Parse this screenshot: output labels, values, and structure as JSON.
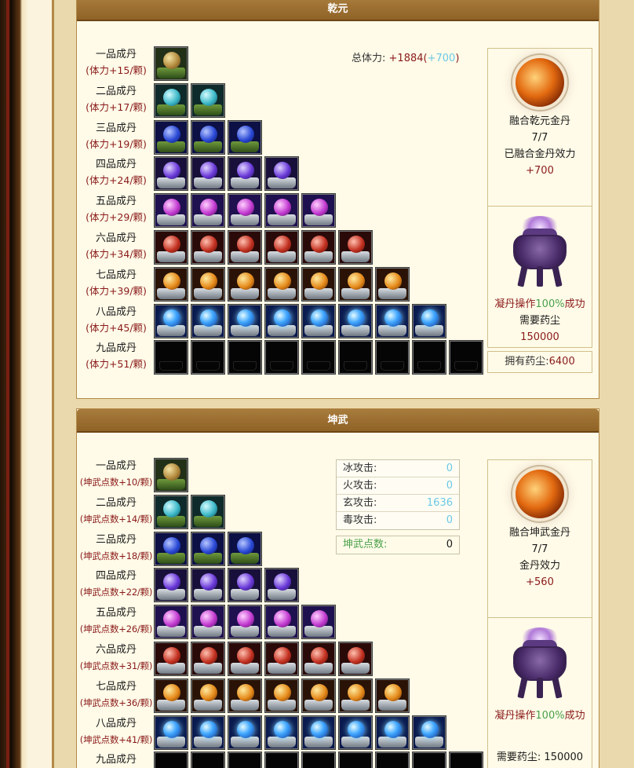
{
  "qianyuan": {
    "title": "乾元",
    "total_label": "总体力:",
    "total_value": "+1884",
    "total_open": "(",
    "total_plus": "+700",
    "total_close": ")",
    "grades": [
      {
        "name": "一品成丹",
        "bonus": "(体力+15/颗)",
        "filled": 1,
        "color": "c1"
      },
      {
        "name": "二品成丹",
        "bonus": "(体力+17/颗)",
        "filled": 2,
        "color": "c2"
      },
      {
        "name": "三品成丹",
        "bonus": "(体力+19/颗)",
        "filled": 3,
        "color": "c3"
      },
      {
        "name": "四品成丹",
        "bonus": "(体力+24/颗)",
        "filled": 4,
        "color": "c4"
      },
      {
        "name": "五品成丹",
        "bonus": "(体力+29/颗)",
        "filled": 5,
        "color": "c5"
      },
      {
        "name": "六品成丹",
        "bonus": "(体力+34/颗)",
        "filled": 6,
        "color": "c6"
      },
      {
        "name": "七品成丹",
        "bonus": "(体力+39/颗)",
        "filled": 7,
        "color": "c7"
      },
      {
        "name": "八品成丹",
        "bonus": "(体力+45/颗)",
        "filled": 8,
        "color": "c8"
      },
      {
        "name": "九品成丹",
        "bonus": "(体力+51/颗)",
        "filled": 0,
        "slots": 9,
        "color": "c9"
      }
    ],
    "fuse_title": "融合乾元金丹",
    "fuse_count": "7/7",
    "fuse_effect_label": "已融合金丹效力",
    "fuse_effect_value": "+700",
    "condense_prefix": "凝丹操作",
    "condense_rate": "100%",
    "condense_suffix": "成功",
    "dust_need_label": "需要药尘",
    "dust_need_value": "150000",
    "owned_dust_label": "拥有药尘:",
    "owned_dust_value": "6400"
  },
  "kunwu": {
    "title": "坤武",
    "grades": [
      {
        "name": "一品成丹",
        "bonus": "(坤武点数+10/颗)",
        "filled": 1,
        "color": "c1"
      },
      {
        "name": "二品成丹",
        "bonus": "(坤武点数+14/颗)",
        "filled": 2,
        "color": "c2"
      },
      {
        "name": "三品成丹",
        "bonus": "(坤武点数+18/颗)",
        "filled": 3,
        "color": "c3"
      },
      {
        "name": "四品成丹",
        "bonus": "(坤武点数+22/颗)",
        "filled": 4,
        "color": "c4"
      },
      {
        "name": "五品成丹",
        "bonus": "(坤武点数+26/颗)",
        "filled": 5,
        "color": "c5"
      },
      {
        "name": "六品成丹",
        "bonus": "(坤武点数+31/颗)",
        "filled": 6,
        "color": "c6"
      },
      {
        "name": "七品成丹",
        "bonus": "(坤武点数+36/颗)",
        "filled": 7,
        "color": "c7"
      },
      {
        "name": "八品成丹",
        "bonus": "(坤武点数+41/颗)",
        "filled": 8,
        "color": "c8"
      },
      {
        "name": "九品成丹",
        "bonus": "",
        "filled": 0,
        "slots": 9,
        "color": "c9"
      }
    ],
    "attacks": [
      {
        "label": "冰攻击:",
        "value": "0"
      },
      {
        "label": "火攻击:",
        "value": "0"
      },
      {
        "label": "玄攻击:",
        "value": "1636"
      },
      {
        "label": "毒攻击:",
        "value": "0"
      }
    ],
    "points_label": "坤武点数:",
    "points_value": "0",
    "fuse_title": "融合坤武金丹",
    "fuse_count": "7/7",
    "fuse_effect_label": "金丹效力",
    "fuse_effect_value": "+560",
    "condense_prefix": "凝丹操作",
    "condense_rate": "100%",
    "condense_suffix": "成功",
    "dust_need_text": "需要药尘: 150000"
  },
  "icons": {
    "pill_icon": "elixir-pill-in-cauldron",
    "golden_pill_icon": "golden-elixir",
    "furnace_icon": "alchemy-furnace"
  }
}
